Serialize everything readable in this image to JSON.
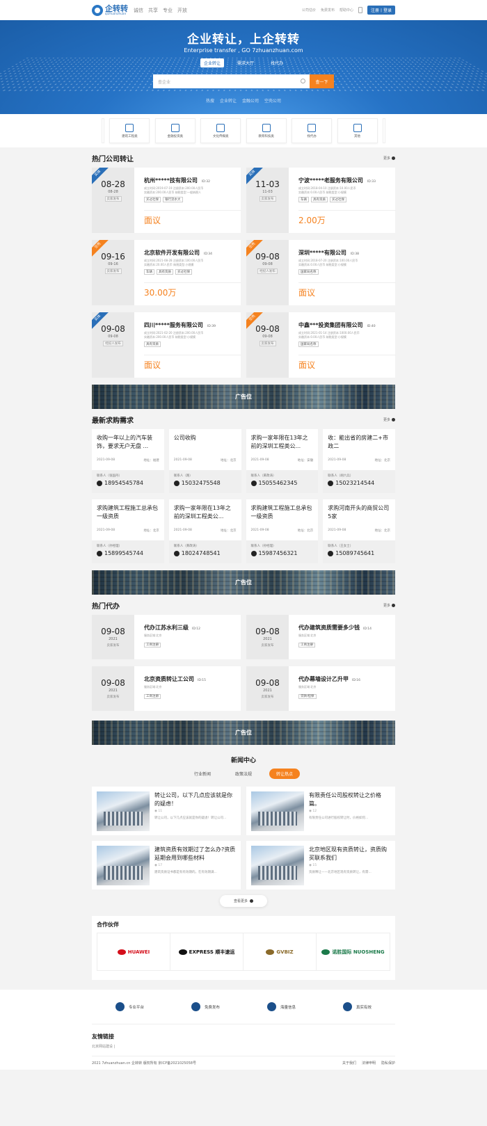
{
  "header": {
    "logo_name": "企转转",
    "logo_sub": "qizhuanzhuan",
    "nav": [
      "诚信",
      "共享",
      "专业",
      "开放"
    ],
    "links": [
      "公司估价",
      "免费发布",
      "帮助中心"
    ],
    "login": "注册丨登录"
  },
  "hero": {
    "title": "企业转让，上企转转",
    "subtitle": "Enterprise transfer , GO 7zhuanzhuan.com",
    "tabs": [
      "企业转让",
      "需求大厅",
      "找代办"
    ],
    "search_placeholder": "查企业",
    "search_button": "查一下",
    "hot_words": [
      "热搜",
      "企业转让",
      "金融公司",
      "空壳公司"
    ]
  },
  "categories": [
    "建筑工程类",
    "金融投资类",
    "文化传媒类",
    "教育科技类",
    "找代办",
    "其他"
  ],
  "hot_companies": {
    "title": "热门公司转让",
    "more": "更多",
    "items": [
      {
        "ribbon": "实体",
        "ribbon_color": "#2a6fb8",
        "date": "08-28",
        "date2": "08-28",
        "tag": "卖家发布",
        "name": "杭州*****技有限公司",
        "id": "ID:32",
        "meta1": "成立时间:2019-07-19  注册资本:200.00人民币",
        "meta2": "实缴资本:200.00人民币  纳税类型:一般纳税人",
        "tags": [
          "买过社保",
          "银行流水大"
        ],
        "price": "面议"
      },
      {
        "ribbon": "实体",
        "ribbon_color": "#2a6fb8",
        "date": "11-03",
        "date2": "11-03",
        "tag": "卖家发布",
        "name": "宁波*****老服务有限公司",
        "id": "ID:33",
        "meta1": "成立时间:2018-04-10  注册资本:10.00人民币",
        "meta2": "实缴资本:0.00人民币  纳税类型:小规模",
        "tags": [
          "车辆",
          "具有资质",
          "买过社保"
        ],
        "price": "2.00万"
      },
      {
        "ribbon": "空壳",
        "ribbon_color": "#f5821f",
        "date": "09-16",
        "date2": "09-16",
        "tag": "卖家发布",
        "name": "北京软件开发有限公司",
        "id": "ID:34",
        "meta1": "成立时间:2021-08-28  注册资本:100.00人民币",
        "meta2": "实缴资本:20.00人民币  纳税类型:小规模",
        "tags": [
          "车辆",
          "具有资质",
          "买过社保"
        ],
        "price": "30.00万"
      },
      {
        "ribbon": "空壳",
        "ribbon_color": "#f5821f",
        "date": "09-08",
        "date2": "09-08",
        "tag": "经纪人发布",
        "name": "深圳*****有限公司",
        "id": "ID:38",
        "meta1": "成立时间:2018-07-20  注册资本:100.00人民币",
        "meta2": "实缴资本:0.00人民币  纳税类型:小规模",
        "tags": [
          "国家局名称"
        ],
        "price": "面议"
      },
      {
        "ribbon": "实体",
        "ribbon_color": "#2a6fb8",
        "date": "09-08",
        "date2": "09-08",
        "tag": "经纪人发布",
        "name": "四川*****服务有限公司",
        "id": "ID:39",
        "meta1": "成立时间:2021-02-20  注册资本:200.00人民币",
        "meta2": "实缴资本:200.00人民币  纳税类型:小规模",
        "tags": [
          "具有资质"
        ],
        "price": "面议"
      },
      {
        "ribbon": "空壳",
        "ribbon_color": "#f5821f",
        "date": "09-08",
        "date2": "09-08",
        "tag": "卖家发布",
        "name": "中鑫***投资集团有限公司",
        "id": "ID:40",
        "meta1": "成立时间:2021-01-14  注册资本:1000.00人民币",
        "meta2": "实缴资本:0.00人民币  纳税类型:小规模",
        "tags": [
          "国家局名称"
        ],
        "price": "面议"
      }
    ]
  },
  "ad_label": "广告位",
  "demands": {
    "title": "最新求购需求",
    "more": "更多",
    "items": [
      {
        "title": "收购一年以上的汽车装饰，要求无户无盘 ...",
        "date": "2021-09-08",
        "addr": "地址：福建",
        "contact": "联系人（张国丹）",
        "phone": "18954545784"
      },
      {
        "title": "公司收购",
        "date": "2021-09-08",
        "addr": "地址：北京",
        "contact": "联系人（路）",
        "phone": "15032475548"
      },
      {
        "title": "求购一家年限在13年之前的深圳工程类公...",
        "date": "2021-09-08",
        "addr": "地址：安徽",
        "contact": "联系人（黄政涛）",
        "phone": "15055462345"
      },
      {
        "title": "收：能出省的房建二+市政二",
        "date": "2021-09-08",
        "addr": "地址：北京",
        "contact": "联系人（胡六兵）",
        "phone": "15023214544"
      },
      {
        "title": "求购建筑工程施工总承包一级资质",
        "date": "2021-09-08",
        "addr": "地址：北京",
        "contact": "联系人（孙经理）",
        "phone": "15899545744"
      },
      {
        "title": "求购一家年限在13年之前的深圳工程类公...",
        "date": "2021-09-08",
        "addr": "地址：北京",
        "contact": "联系人（黄政涛）",
        "phone": "18024748541"
      },
      {
        "title": "求购建筑工程施工总承包一级资质",
        "date": "2021-09-08",
        "addr": "地址：北京",
        "contact": "联系人（孙经理）",
        "phone": "15987456321"
      },
      {
        "title": "求购河南开头的商贸公司5家",
        "date": "2021-09-08",
        "addr": "地址：北京",
        "contact": "联系人（王女士）",
        "phone": "15089745641"
      }
    ]
  },
  "agency": {
    "title": "热门代办",
    "more": "更多",
    "items": [
      {
        "date": "09-08",
        "year": "2021",
        "tag": "卖家发布",
        "name": "代办江苏水利三级",
        "id": "ID:12",
        "area": "服务区域:北京",
        "tag2": "工商注册"
      },
      {
        "date": "09-08",
        "year": "2021",
        "tag": "卖家发布",
        "name": "代办建筑资质需要多少钱",
        "id": "ID:14",
        "area": "服务区域:北京",
        "tag2": "工商注册"
      },
      {
        "date": "09-08",
        "year": "2021",
        "tag": "卖家发布",
        "name": "北京资质转让工公司",
        "id": "ID:15",
        "area": "服务区域:北京",
        "tag2": "工商注册"
      },
      {
        "date": "09-08",
        "year": "2021",
        "tag": "卖家发布",
        "name": "代办幕墙设计乙升甲",
        "id": "ID:16",
        "area": "服务区域:北京",
        "tag2": "贷款/担保"
      }
    ]
  },
  "news": {
    "title": "新闻中心",
    "tabs": [
      "行业新闻",
      "政策法规",
      "转让热点"
    ],
    "items": [
      {
        "title": "转让公司，以下几点应该就是你的疑虑！",
        "views": "11",
        "summary": "转让公司，以下几点应该就是你的疑虑！转让公司..."
      },
      {
        "title": "有限责任公司股权转让之价格篇。",
        "views": "12",
        "summary": "有限责任公司进行股权转让时，价格如何..."
      },
      {
        "title": "建筑资质有效期过了怎么办?资质延期会用到哪些材料",
        "views": "17",
        "summary": "建筑资质证书都是有有效期的。在有效期满..."
      },
      {
        "title": "北京地区现有资质转让，资质购买联系我们",
        "views": "15",
        "summary": "资质释让——北京地区现有资质转让，有需..."
      }
    ],
    "view_more": "查看更多"
  },
  "partners": {
    "title": "合作伙伴",
    "logos": [
      {
        "name": "HUAWEI",
        "color": "#d40f1b"
      },
      {
        "name": "EXPRESS 顺丰速运",
        "color": "#111111"
      },
      {
        "name": "GVBIZ",
        "color": "#8a6a2a"
      },
      {
        "name": "诺胜国际 NUOSHENG",
        "color": "#1b7a4a"
      }
    ]
  },
  "footer": {
    "features": [
      "专业平台",
      "免费发布",
      "海量信息",
      "真实有效"
    ],
    "links_title": "友情链接",
    "links": "北京网站建设  |",
    "copyright": "2021 7zhuanzhuan.cn 企转转 版权所有 京ICP备2021025058号",
    "bottom_links": [
      "关于我们",
      "法律申明",
      "隐私保护"
    ]
  }
}
